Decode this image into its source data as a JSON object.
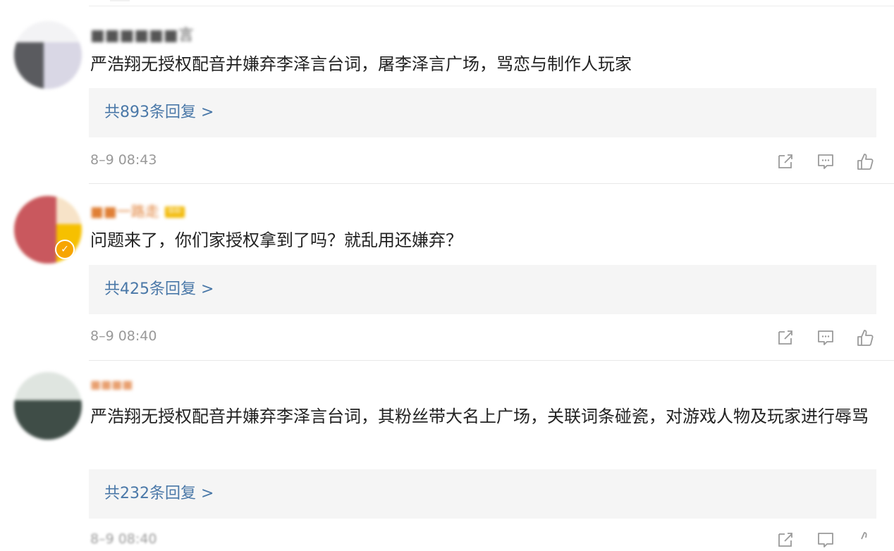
{
  "comments": [
    {
      "username": "■■■■■■言",
      "content": "严浩翔无授权配音并嫌弃李泽言台词，屠李泽言广场，骂恋与制作人玩家",
      "reply_label": "共893条回复 >",
      "timestamp": "8–9 08:43"
    },
    {
      "username": "■■一路走",
      "fan_badge": "铁粉",
      "verified": true,
      "content": "问题来了，你们家授权拿到了吗？就乱用还嫌弃？",
      "reply_label": "共425条回复 >",
      "timestamp": "8–9 08:40"
    },
    {
      "username": "■■■■",
      "content": "严浩翔无授权配音并嫌弃李泽言台词，其粉丝带大名上广场，关联词条碰瓷，对游戏人物及玩家进行辱骂",
      "reply_label": "共232条回复 >",
      "timestamp": "8–9 08:40"
    }
  ],
  "icons": {
    "share": "share-icon",
    "comment": "comment-icon",
    "like": "like-icon"
  },
  "colors": {
    "reply_link": "#4a78a8",
    "reply_bg": "#f5f5f5",
    "badge": "#f7a500",
    "timestamp": "#999999"
  }
}
